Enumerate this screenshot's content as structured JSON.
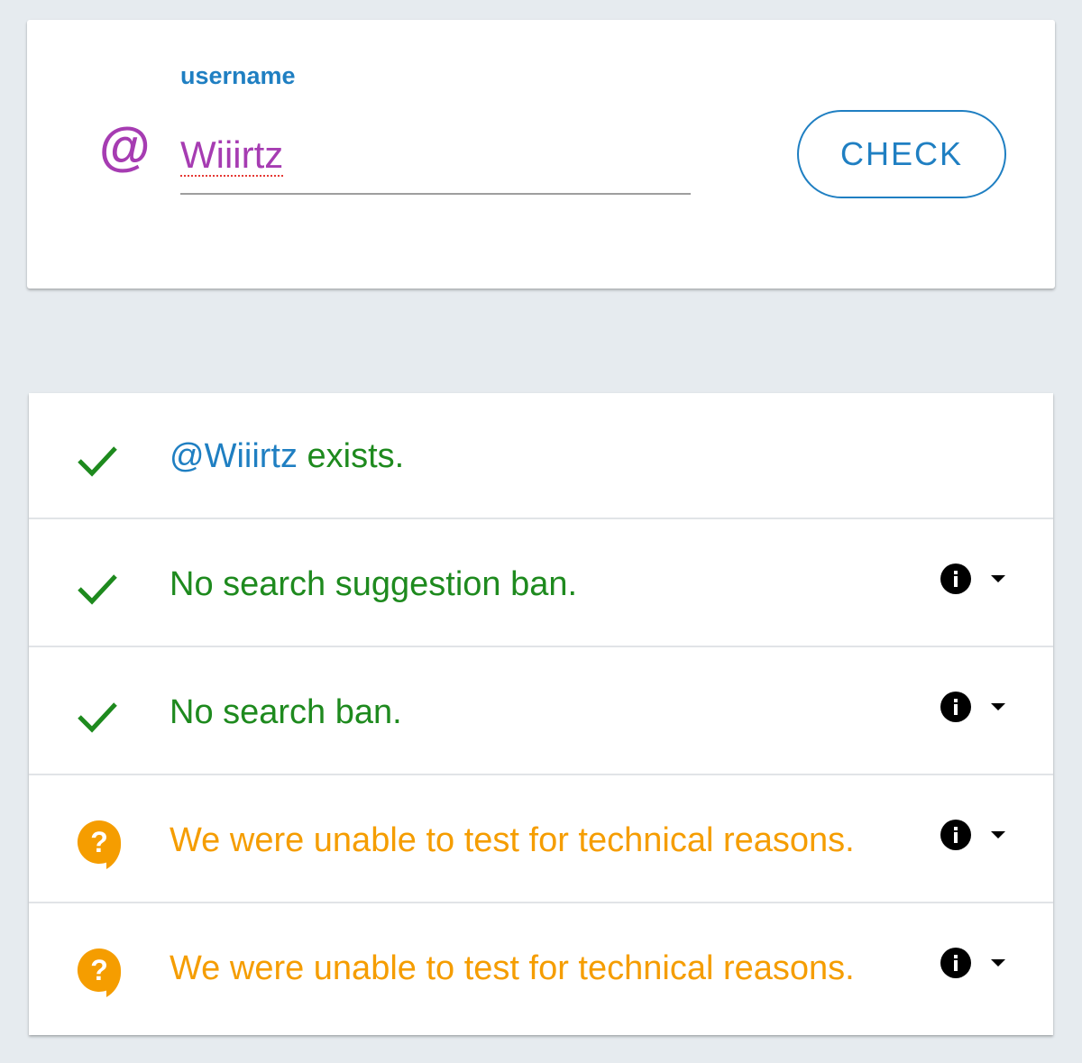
{
  "username_form": {
    "label": "username",
    "at_symbol": "@",
    "value": "Wiiirtz",
    "check_label": "CHECK"
  },
  "results": [
    {
      "status": "ok",
      "handle": "@Wiiirtz",
      "text": " exists.",
      "has_info": false
    },
    {
      "status": "ok",
      "text": "No search suggestion ban.",
      "has_info": true
    },
    {
      "status": "ok",
      "text": "No search ban.",
      "has_info": true
    },
    {
      "status": "unknown",
      "text": "We were unable to test for technical reasons.",
      "has_info": true
    },
    {
      "status": "unknown",
      "text": "We were unable to test for technical reasons.",
      "has_info": true
    }
  ],
  "colors": {
    "ok": "#1e8a1e",
    "unknown": "#f59d00",
    "handle": "#1f7fc2",
    "accent_purple": "#a63cb2"
  },
  "icons": {
    "ok": "checkmark-icon",
    "unknown": "question-icon",
    "info": "info-icon",
    "caret": "caret-down-icon"
  }
}
